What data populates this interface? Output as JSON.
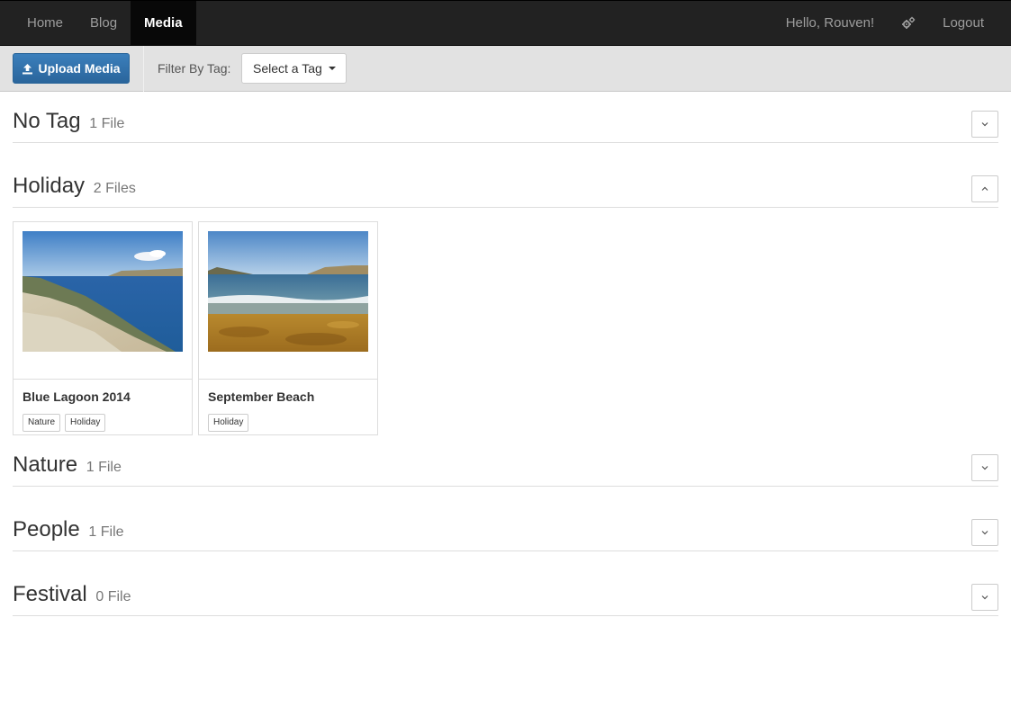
{
  "navbar": {
    "items": [
      {
        "label": "Home"
      },
      {
        "label": "Blog"
      },
      {
        "label": "Media"
      }
    ],
    "greeting": "Hello, Rouven!",
    "settings_icon": "gears-icon",
    "logout_label": "Logout",
    "active_color": "#080808",
    "bg_color": "#222222"
  },
  "toolbar": {
    "upload_label": "Upload Media",
    "upload_icon": "upload-icon",
    "filter_label": "Filter By Tag:",
    "filter_value": "Select a Tag",
    "accent_color": "#2d6ca2"
  },
  "sections": [
    {
      "title": "No Tag",
      "count": "1 File",
      "expanded": false
    },
    {
      "title": "Holiday",
      "count": "2 Files",
      "expanded": true
    },
    {
      "title": "Nature",
      "count": "1 File",
      "expanded": false
    },
    {
      "title": "People",
      "count": "1 File",
      "expanded": false
    },
    {
      "title": "Festival",
      "count": "0 File",
      "expanded": false
    }
  ],
  "holiday_media": [
    {
      "title": "Blue Lagoon 2014",
      "tags": [
        "Nature",
        "Holiday"
      ]
    },
    {
      "title": "September Beach",
      "tags": [
        "Holiday"
      ]
    }
  ]
}
